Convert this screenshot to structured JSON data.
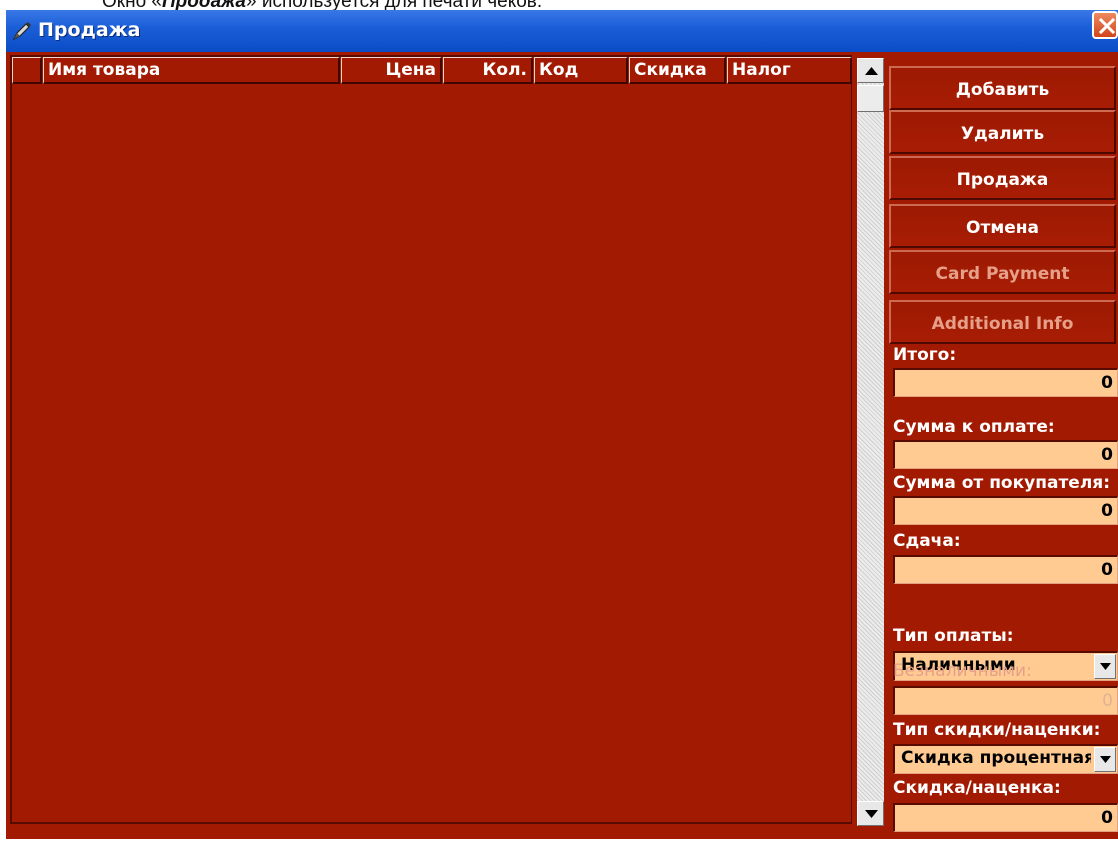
{
  "document": {
    "caption_prefix": "Окно «",
    "caption_bold": "Продажа",
    "caption_suffix": "» используется для печати чеков."
  },
  "window": {
    "title": "Продажа"
  },
  "table": {
    "columns": [
      "",
      "Имя товара",
      "Цена",
      "Кол.",
      "Код",
      "Скидка",
      "Налог"
    ],
    "rows": []
  },
  "buttons": {
    "add": "Добавить",
    "delete": "Удалить",
    "sale": "Продажа",
    "cancel": "Отмена",
    "card_payment": "Card Payment",
    "additional_info": "Additional Info"
  },
  "totals": {
    "total_label": "Итого:",
    "total_value": "0",
    "amount_due_label": "Сумма к оплате:",
    "amount_due_value": "0",
    "from_customer_label": "Сумма от покупателя:",
    "from_customer_value": "0",
    "change_label": "Сдача:",
    "change_value": "0"
  },
  "payment": {
    "type_label": "Тип оплаты:",
    "type_value": "Наличными",
    "cashless_label": "Безналичными:",
    "cashless_value": "0"
  },
  "discount": {
    "type_label": "Тип скидки/наценки:",
    "type_value": "Скидка процентная",
    "amount_label": "Скидка/наценка:",
    "amount_value": "0"
  },
  "colors": {
    "window_bg": "#a31a02",
    "field_bg": "#ffcb92",
    "titlebar": "#0a4cc6",
    "disabled_text": "#e6a089"
  },
  "icons": {
    "title": "pen-icon",
    "close": "close-icon",
    "scroll_up": "arrow-up-icon",
    "scroll_down": "arrow-down-icon",
    "dropdown": "chevron-down-icon"
  }
}
